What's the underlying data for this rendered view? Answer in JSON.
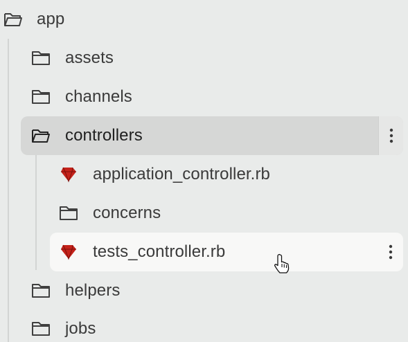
{
  "tree": {
    "root": {
      "label": "app",
      "icon": "folder-open-icon"
    },
    "items": [
      {
        "label": "assets",
        "icon": "folder-icon"
      },
      {
        "label": "channels",
        "icon": "folder-icon"
      },
      {
        "label": "controllers",
        "icon": "folder-open-icon",
        "state": "selected"
      },
      {
        "label": "application_controller.rb",
        "icon": "ruby-file-icon"
      },
      {
        "label": "concerns",
        "icon": "folder-icon"
      },
      {
        "label": "tests_controller.rb",
        "icon": "ruby-file-icon",
        "state": "hovered"
      },
      {
        "label": "helpers",
        "icon": "folder-icon"
      },
      {
        "label": "jobs",
        "icon": "folder-icon"
      }
    ]
  },
  "colors": {
    "background": "#e9ebea",
    "selected_row": "#d6d7d6",
    "hovered_row": "#f8f8f7",
    "ruby_red": "#c4221a"
  }
}
